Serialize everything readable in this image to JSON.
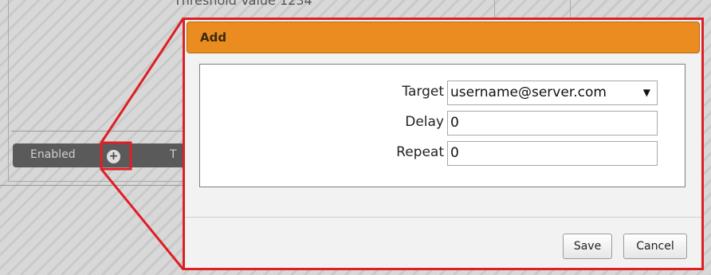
{
  "background": {
    "threshold_text": "Threshold Value 1234",
    "enabled_label": "Enabled",
    "add_symbol": "+",
    "truncated_label": "T"
  },
  "dialog": {
    "title": "Add",
    "fields": {
      "target_label": "Target",
      "target_value": "username@server.com",
      "target_arrow": "▼",
      "delay_label": "Delay",
      "delay_value": "0",
      "repeat_label": "Repeat",
      "repeat_value": "0"
    },
    "buttons": {
      "save": "Save",
      "cancel": "Cancel"
    }
  },
  "colors": {
    "header": "#ea8c1f",
    "callout": "#dd1f26"
  }
}
